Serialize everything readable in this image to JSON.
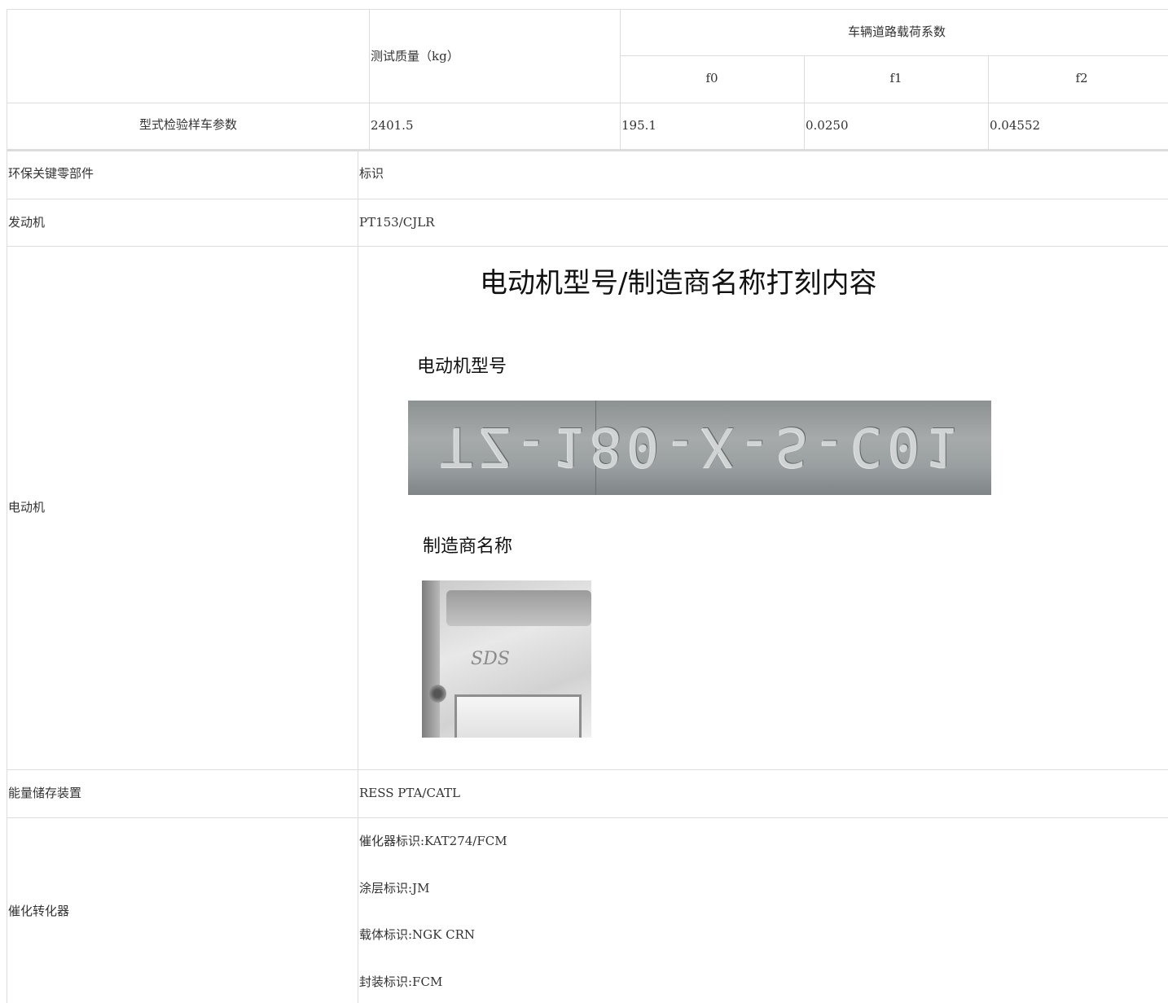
{
  "table1": {
    "col_test_mass": "测试质量（kg）",
    "col_load_coeff": "车辆道路载荷系数",
    "sub_f0": "f0",
    "sub_f1": "f1",
    "sub_f2": "f2",
    "row_label": "型式检验样车参数",
    "row_mass": "2401.5",
    "row_f0": "195.1",
    "row_f1": "0.0250",
    "row_f2": "0.04552"
  },
  "table2": {
    "header_left": "环保关键零部件",
    "header_right": "标识",
    "engine_label": "发动机",
    "engine_value": "PT153/CJLR",
    "motor_label": "电动机",
    "motor_image": {
      "title": "电动机型号/制造商名称打刻内容",
      "model_caption": "电动机型号",
      "model_engraving": "TZ-180-X-S-C01",
      "maker_caption": "制造商名称",
      "maker_logo": "SDS"
    },
    "ress_label": "能量储存装置",
    "ress_value": "RESS PTA/CATL",
    "catalyst_label": "催化转化器",
    "catalyst_lines": [
      "催化器标识:KAT274/FCM",
      "涂层标识:JM",
      "载体标识:NGK CRN",
      "封装标识:FCM"
    ]
  }
}
